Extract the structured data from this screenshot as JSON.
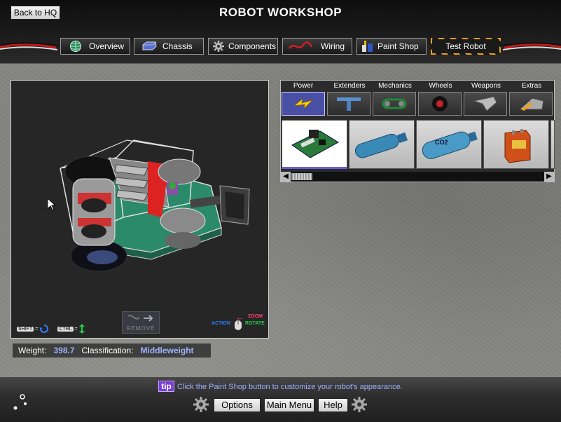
{
  "header": {
    "title": "ROBOT WORKSHOP",
    "back_label": "Back to HQ"
  },
  "tabs": [
    {
      "label": "Overview",
      "icon": "globe-icon"
    },
    {
      "label": "Chassis",
      "icon": "chassis-icon"
    },
    {
      "label": "Components",
      "icon": "gear-icon"
    },
    {
      "label": "Wiring",
      "icon": "wire-icon"
    },
    {
      "label": "Paint Shop",
      "icon": "paint-cans-icon"
    },
    {
      "label": "Test Robot",
      "icon": ""
    }
  ],
  "viewport": {
    "remove_label": "REMOVE",
    "shift_key": "SHIFT",
    "ctrl_key": "CTRL",
    "equals": "=",
    "zoom_label": "ZOOM",
    "action_label": "ACTION",
    "rotate_label": "ROTATE"
  },
  "status": {
    "weight_label": "Weight:",
    "weight_value": "398.7",
    "class_label": "Classification:",
    "class_value": "Middleweight"
  },
  "parts": {
    "categories": [
      {
        "label": "Power",
        "icon": "lightning-icon",
        "selected": true
      },
      {
        "label": "Extenders",
        "icon": "t-beam-icon",
        "selected": false
      },
      {
        "label": "Mechanics",
        "icon": "chain-drive-icon",
        "selected": false
      },
      {
        "label": "Wheels",
        "icon": "wheel-icon",
        "selected": false
      },
      {
        "label": "Weapons",
        "icon": "blade-icon",
        "selected": false
      },
      {
        "label": "Extras",
        "icon": "wedge-icon",
        "selected": false
      }
    ],
    "items": [
      {
        "name": "circuit-board",
        "selected": true
      },
      {
        "name": "gas-tank-blue",
        "label": "",
        "selected": false
      },
      {
        "name": "co2-tank",
        "label": "CO2",
        "selected": false
      },
      {
        "name": "power-cell",
        "label": "",
        "selected": false
      }
    ]
  },
  "footer": {
    "tip_badge": "tip",
    "tip_text": "Click the Paint Shop button to customize your robot's appearance.",
    "options_label": "Options",
    "main_menu_label": "Main Menu",
    "help_label": "Help"
  },
  "colors": {
    "accent_blue": "#9bb3ff",
    "tip_purple": "#7a3fd2",
    "selected_category": "#4a4fa6",
    "hazard_orange": "#e8a020"
  }
}
